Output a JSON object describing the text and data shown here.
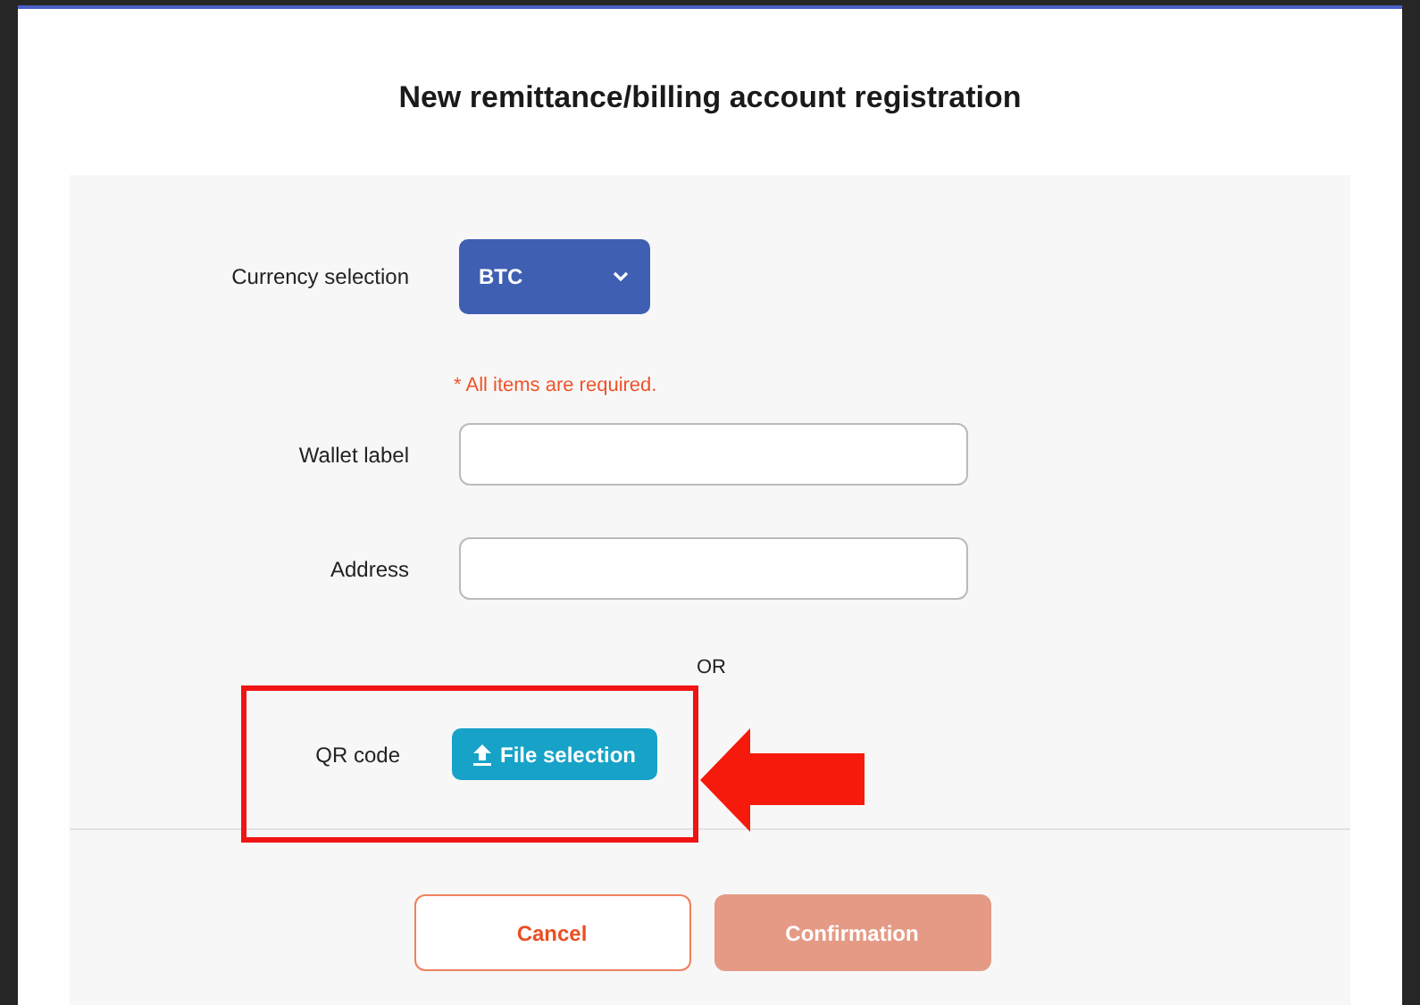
{
  "title": "New remittance/billing account registration",
  "currency": {
    "label": "Currency selection",
    "value": "BTC"
  },
  "required_note": "* All items are required.",
  "fields": [
    {
      "label": "Wallet label"
    },
    {
      "label": "Address"
    }
  ],
  "or_text": "OR",
  "qr": {
    "label": "QR code",
    "button": "File selection"
  },
  "buttons": [
    {
      "label": "Cancel",
      "kind": "outline",
      "disabled": false
    },
    {
      "label": "Confirmation",
      "kind": "primary",
      "disabled": true
    }
  ]
}
